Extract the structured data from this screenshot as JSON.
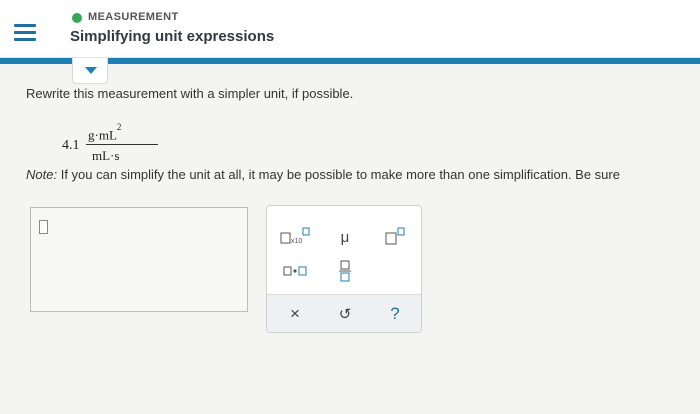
{
  "header": {
    "section_label": "MEASUREMENT",
    "topic_title": "Simplifying unit expressions",
    "accent_color": "#1f7fb5",
    "status_color": "#34a853"
  },
  "question": {
    "prompt": "Rewrite this measurement with a simpler unit, if possible.",
    "coefficient": "4.1",
    "numerator": "g·mL",
    "numerator_exponent": "2",
    "denominator": "mL·s",
    "note_label": "Note:",
    "note_text": "If you can simplify the unit at all, it may be possible to make more than one simplification. Be sure"
  },
  "keypad": {
    "sci_label": "x10",
    "mu_symbol": "μ",
    "clear_symbol": "×",
    "undo_symbol": "↺",
    "help_symbol": "?"
  },
  "icons": {
    "menu": "hamburger-icon",
    "collapse": "triangle-down-icon"
  }
}
